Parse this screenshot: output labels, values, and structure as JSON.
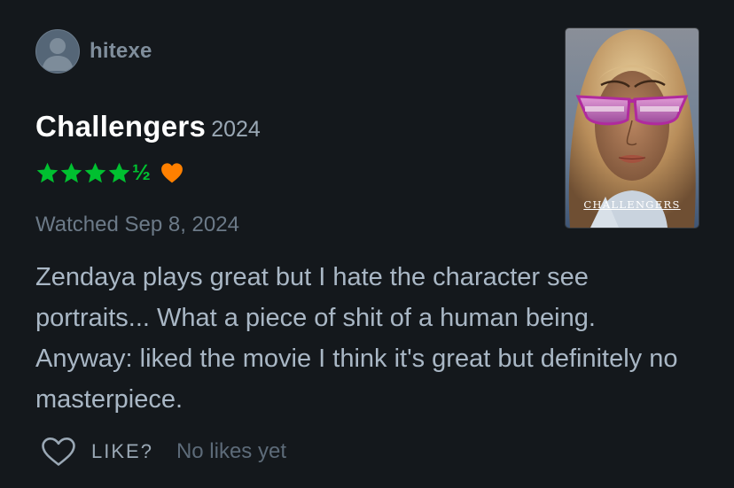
{
  "user": {
    "name": "hitexe"
  },
  "film": {
    "title": "Challengers",
    "year": "2024",
    "rating_stars": 4.5,
    "rating_half_glyph": "½",
    "liked": true,
    "poster_title": "CHALLENGERS"
  },
  "review": {
    "watched": "Watched Sep 8, 2024",
    "text": "Zendaya plays great but I hate the character see portraits... What a piece of shit of a human being. Anyway: liked the movie I think it's great but definitely no masterpiece."
  },
  "actions": {
    "like_label": "LIKE?",
    "likes_text": "No likes yet"
  },
  "icons": {
    "avatar": "user-avatar-icon",
    "star": "star-icon",
    "liked_heart": "heart-filled-icon",
    "like_heart": "heart-outline-icon"
  },
  "colors": {
    "background": "#14181c",
    "star": "#00c030",
    "liked_heart": "#ff8000",
    "text": "#a9b7c5",
    "muted": "#6c7a88"
  }
}
